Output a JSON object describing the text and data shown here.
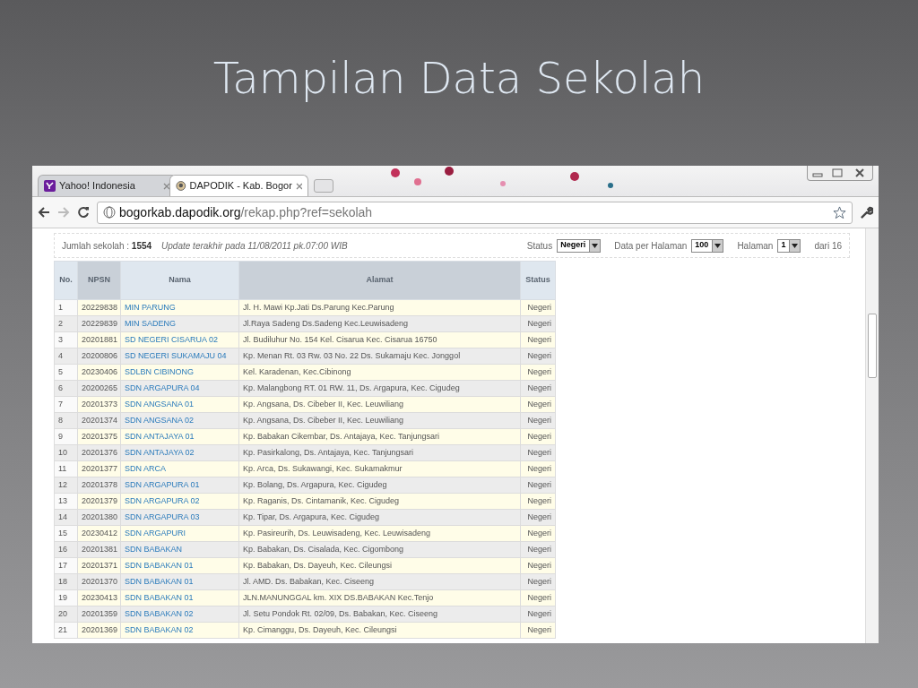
{
  "slide_title": "Tampilan Data Sekolah",
  "browser": {
    "tabs": [
      {
        "label": "Yahoo! Indonesia",
        "selected": false,
        "kind": "yahoo"
      },
      {
        "label": "DAPODIK - Kab. Bogor",
        "selected": true,
        "kind": "emblem"
      }
    ],
    "address": {
      "domain": "bogorkab.dapodik.org",
      "path": "/rekap.php?ref=sekolah"
    }
  },
  "info": {
    "count_label": "Jumlah sekolah :",
    "count": "1554",
    "update_text": "Update terakhir pada 11/08/2011 pk.07:00 WIB"
  },
  "filters": [
    {
      "label": "Status",
      "value": "Negeri"
    },
    {
      "label": "Data per Halaman",
      "value": "100"
    },
    {
      "label": "Halaman",
      "value": "1"
    }
  ],
  "page_total": "dari 16",
  "table": {
    "columns": [
      "No.",
      "NPSN",
      "Nama",
      "Alamat",
      "Status"
    ],
    "rows": [
      [
        "1",
        "20229838",
        "MIN PARUNG",
        "Jl. H. Mawi Kp.Jati Ds.Parung Kec.Parung",
        "Negeri"
      ],
      [
        "2",
        "20229839",
        "MIN SADENG",
        "Jl.Raya Sadeng Ds.Sadeng Kec.Leuwisadeng",
        "Negeri"
      ],
      [
        "3",
        "20201881",
        "SD NEGERI CISARUA 02",
        "Jl. Budiluhur No. 154 Kel. Cisarua Kec. Cisarua 16750",
        "Negeri"
      ],
      [
        "4",
        "20200806",
        "SD NEGERI SUKAMAJU 04",
        "Kp. Menan Rt. 03 Rw. 03 No. 22 Ds. Sukamaju Kec. Jonggol",
        "Negeri"
      ],
      [
        "5",
        "20230406",
        "SDLBN CIBINONG",
        "Kel. Karadenan, Kec.Cibinong",
        "Negeri"
      ],
      [
        "6",
        "20200265",
        "SDN ARGAPURA 04",
        "Kp. Malangbong RT. 01 RW. 11, Ds. Argapura, Kec. Cigudeg",
        "Negeri"
      ],
      [
        "7",
        "20201373",
        "SDN ANGSANA 01",
        "Kp. Angsana, Ds. Cibeber II, Kec. Leuwiliang",
        "Negeri"
      ],
      [
        "8",
        "20201374",
        "SDN ANGSANA 02",
        "Kp. Angsana, Ds. Cibeber II, Kec. Leuwiliang",
        "Negeri"
      ],
      [
        "9",
        "20201375",
        "SDN ANTAJAYA 01",
        "Kp. Babakan Cikembar, Ds. Antajaya, Kec. Tanjungsari",
        "Negeri"
      ],
      [
        "10",
        "20201376",
        "SDN ANTAJAYA 02",
        "Kp. Pasirkalong, Ds. Antajaya, Kec. Tanjungsari",
        "Negeri"
      ],
      [
        "11",
        "20201377",
        "SDN ARCA",
        "Kp. Arca, Ds. Sukawangi, Kec. Sukamakmur",
        "Negeri"
      ],
      [
        "12",
        "20201378",
        "SDN ARGAPURA 01",
        "Kp. Bolang, Ds. Argapura, Kec. Cigudeg",
        "Negeri"
      ],
      [
        "13",
        "20201379",
        "SDN ARGAPURA 02",
        "Kp. Raganis, Ds. Cintamanik, Kec. Cigudeg",
        "Negeri"
      ],
      [
        "14",
        "20201380",
        "SDN ARGAPURA 03",
        "Kp. Tipar, Ds. Argapura, Kec. Cigudeg",
        "Negeri"
      ],
      [
        "15",
        "20230412",
        "SDN ARGAPURI",
        "Kp. Pasireurih, Ds. Leuwisadeng, Kec. Leuwisadeng",
        "Negeri"
      ],
      [
        "16",
        "20201381",
        "SDN BABAKAN",
        "Kp. Babakan, Ds. Cisalada, Kec. Cigombong",
        "Negeri"
      ],
      [
        "17",
        "20201371",
        "SDN BABAKAN 01",
        "Kp. Babakan, Ds. Dayeuh, Kec. Cileungsi",
        "Negeri"
      ],
      [
        "18",
        "20201370",
        "SDN BABAKAN 01",
        "Jl. AMD. Ds. Babakan, Kec. Ciseeng",
        "Negeri"
      ],
      [
        "19",
        "20230413",
        "SDN BABAKAN 01",
        "JLN.MANUNGGAL km. XIX DS.BABAKAN Kec.Tenjo",
        "Negeri"
      ],
      [
        "20",
        "20201359",
        "SDN BABAKAN 02",
        "Jl. Setu Pondok Rt. 02/09, Ds. Babakan, Kec. Ciseeng",
        "Negeri"
      ],
      [
        "21",
        "20201369",
        "SDN BABAKAN 02",
        "Kp. Cimanggu, Ds. Dayeuh, Kec. Cileungsi",
        "Negeri"
      ]
    ]
  }
}
